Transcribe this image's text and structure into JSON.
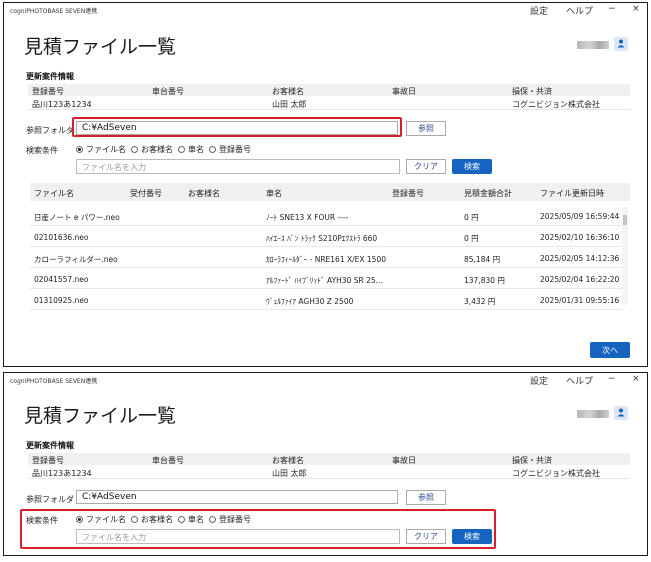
{
  "window": {
    "app_name": "cogniPHOTOBASE SEVEN連携",
    "menu_settings": "設定",
    "menu_help": "ヘルプ",
    "minimize": "−",
    "close": "×"
  },
  "page_title": "見積ファイル一覧",
  "case_info": {
    "heading": "更新案件情報",
    "headers": [
      "登録番号",
      "車台番号",
      "お客様名",
      "事故日",
      "損保・共済"
    ],
    "values": [
      "品川123あ1234",
      "",
      "山田 太郎",
      "",
      "コグニビジョン株式会社"
    ]
  },
  "reference_folder": {
    "label": "参照フォルダ",
    "value": "C:¥AdSeven",
    "browse_label": "参照"
  },
  "search": {
    "label": "検索条件",
    "options": [
      "ファイル名",
      "お客様名",
      "車名",
      "登録番号"
    ],
    "selected": "ファイル名",
    "placeholder": "ファイル名を入力",
    "clear_label": "クリア",
    "search_label": "検索"
  },
  "file_table": {
    "headers": [
      "ファイル名",
      "受付番号",
      "お客様名",
      "車名",
      "登録番号",
      "見積金額合計",
      "ファイル更新日時"
    ],
    "rows": [
      {
        "file": "日産ノート e パワー.neo",
        "car": "ﾉｰﾄ SNE13 X FOUR ----",
        "amount": "0 円",
        "updated": "2025/05/09 16:59:44"
      },
      {
        "file": "02101636.neo",
        "car": "ﾊｲｴｰｽ ﾊﾞﾝ ﾄﾗｯｸ S210Pｴｸｽﾄﾗ 660",
        "amount": "0 円",
        "updated": "2025/02/10 16:36:10"
      },
      {
        "file": "カローラフィルダー.neo",
        "car": "ｶﾛｰﾗﾌｨｰﾙﾀﾞｰ - NRE161 X/EX 1500",
        "amount": "85,184 円",
        "updated": "2025/02/05 14:12:36"
      },
      {
        "file": "02041557.neo",
        "car": "ｱﾙﾌｧｰﾄﾞ ﾊｲﾌﾞﾘｯﾄﾞ AYH30 SR 25...",
        "amount": "137,830 円",
        "updated": "2025/02/04 16:22:20"
      },
      {
        "file": "01310925.neo",
        "car": "ｳﾞｪﾙﾌｧｲｱ AGH30 Z 2500",
        "amount": "3,432 円",
        "updated": "2025/01/31 09:55:16"
      }
    ]
  },
  "next_label": "次へ",
  "colors": {
    "primary": "#1564c0",
    "highlight": "#d6202a",
    "header_bg": "#f0f0f0"
  }
}
